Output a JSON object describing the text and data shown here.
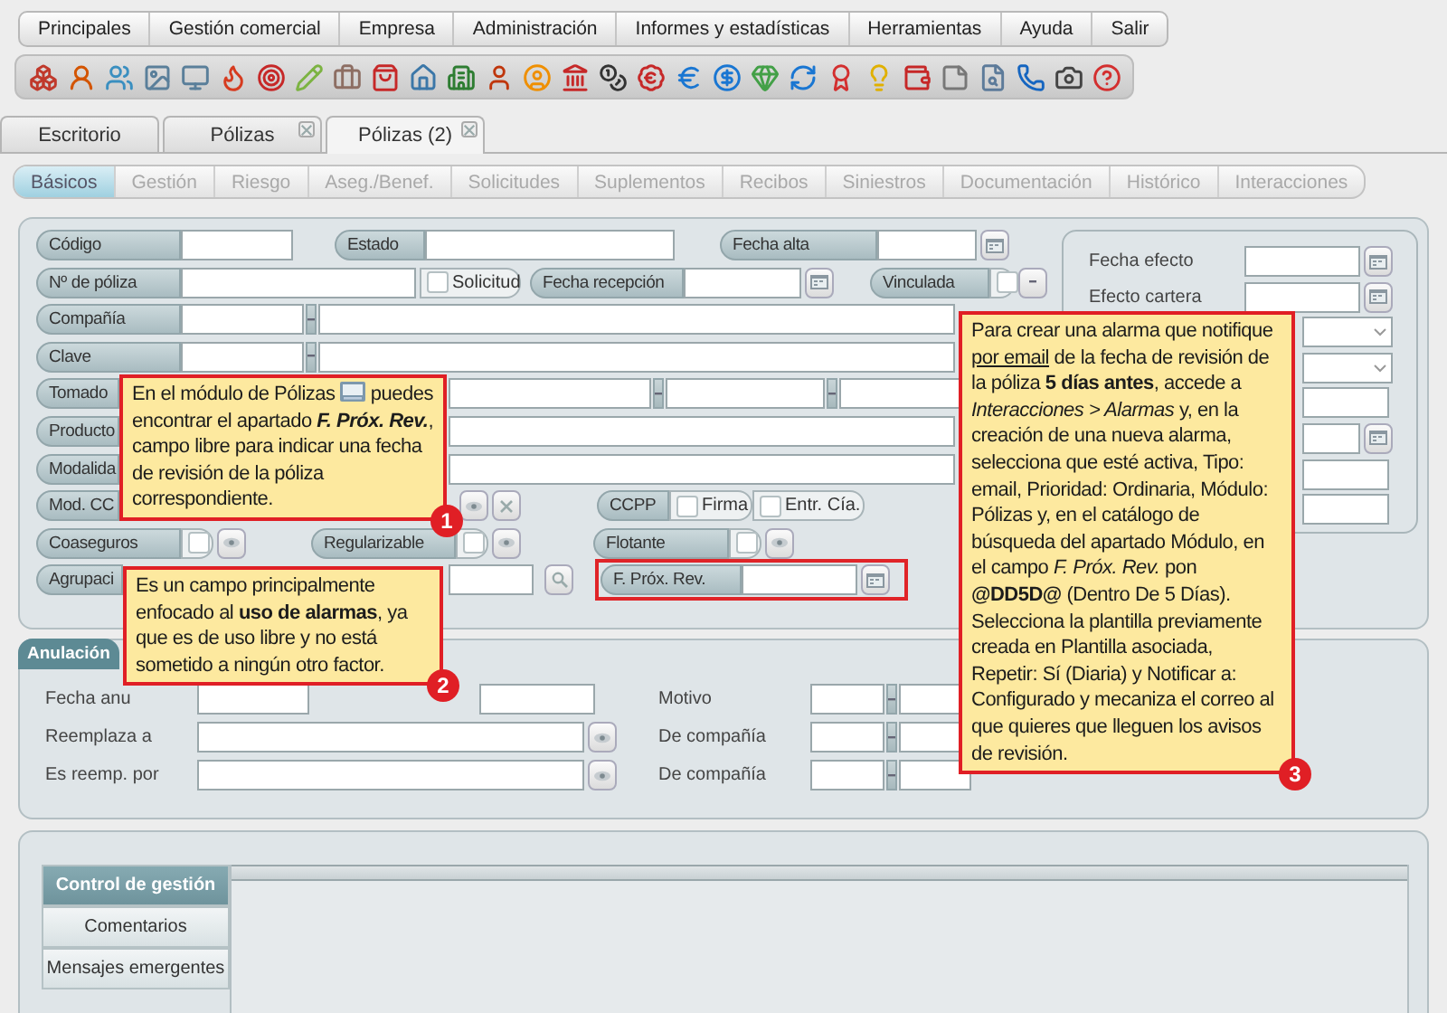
{
  "menu": [
    {
      "label": "Principales"
    },
    {
      "label": "Gestión comercial"
    },
    {
      "label": "Empresa"
    },
    {
      "label": "Administración"
    },
    {
      "label": "Informes y estadísticas"
    },
    {
      "label": "Herramientas"
    },
    {
      "label": "Ayuda"
    },
    {
      "label": "Salir"
    }
  ],
  "tabs": [
    {
      "label": "Escritorio",
      "selected": false,
      "closable": false
    },
    {
      "label": "Pólizas",
      "selected": false,
      "closable": true
    },
    {
      "label": "Pólizas (2)",
      "selected": true,
      "closable": true
    }
  ],
  "subtabs": [
    {
      "label": "Básicos",
      "selected": true,
      "disabled": false
    },
    {
      "label": "Gestión",
      "selected": false,
      "disabled": true
    },
    {
      "label": "Riesgo",
      "selected": false,
      "disabled": true
    },
    {
      "label": "Aseg./Benef.",
      "selected": false,
      "disabled": true
    },
    {
      "label": "Solicitudes",
      "selected": false,
      "disabled": true
    },
    {
      "label": "Suplementos",
      "selected": false,
      "disabled": true
    },
    {
      "label": "Recibos",
      "selected": false,
      "disabled": true
    },
    {
      "label": "Siniestros",
      "selected": false,
      "disabled": true
    },
    {
      "label": "Documentación",
      "selected": false,
      "disabled": true
    },
    {
      "label": "Histórico",
      "selected": false,
      "disabled": true
    },
    {
      "label": "Interacciones",
      "selected": false,
      "disabled": true
    }
  ],
  "policy_form": {
    "lines": [
      [
        {
          "kind": "label",
          "text": "Código"
        },
        {
          "kind": "input"
        },
        {
          "kind": "label",
          "text": "Estado"
        },
        {
          "kind": "input"
        },
        {
          "kind": "label",
          "text": "Fecha alta"
        },
        {
          "kind": "input"
        },
        {
          "kind": "calendar"
        }
      ],
      [
        {
          "kind": "label",
          "text": "Nº de póliza"
        },
        {
          "kind": "input"
        },
        {
          "kind": "checkbox",
          "text": "Solicitud",
          "checked": false
        },
        {
          "kind": "label",
          "text": "Fecha recepción"
        },
        {
          "kind": "input"
        },
        {
          "kind": "calendar"
        },
        {
          "kind": "label",
          "text": "Vinculada"
        },
        {
          "kind": "checkbox",
          "checked": false
        },
        {
          "kind": "spin"
        }
      ],
      [
        {
          "kind": "label",
          "text": "Compañía"
        },
        {
          "kind": "input"
        },
        {
          "kind": "sep"
        },
        {
          "kind": "input"
        }
      ],
      [
        {
          "kind": "label",
          "text": "Clave"
        },
        {
          "kind": "input"
        },
        {
          "kind": "sep"
        },
        {
          "kind": "input"
        }
      ],
      [
        {
          "kind": "label",
          "text": "Tomado"
        },
        {
          "kind": "input"
        },
        {
          "kind": "sep"
        },
        {
          "kind": "input"
        },
        {
          "kind": "sep"
        },
        {
          "kind": "input"
        }
      ],
      [
        {
          "kind": "label",
          "text": "Producto"
        },
        {
          "kind": "input"
        }
      ],
      [
        {
          "kind": "label",
          "text": "Modalida"
        },
        {
          "kind": "input"
        }
      ],
      [
        {
          "kind": "label",
          "text": "Mod. CC"
        },
        {
          "kind": "eye"
        },
        {
          "kind": "clear"
        },
        {
          "kind": "label",
          "text": "CCPP"
        },
        {
          "kind": "checkbox",
          "text": "Firma",
          "checked": false
        },
        {
          "kind": "checkbox",
          "text": "Entr. Cía.",
          "checked": false
        }
      ],
      [
        {
          "kind": "label",
          "text": "Coaseguros"
        },
        {
          "kind": "checkbox",
          "checked": false
        },
        {
          "kind": "eye"
        },
        {
          "kind": "label",
          "text": "Regularizable"
        },
        {
          "kind": "checkbox",
          "checked": false
        },
        {
          "kind": "eye"
        },
        {
          "kind": "label",
          "text": "Flotante"
        },
        {
          "kind": "checkbox",
          "checked": false
        },
        {
          "kind": "eye"
        }
      ],
      [
        {
          "kind": "label",
          "text": "Agrupaci"
        },
        {
          "kind": "input"
        },
        {
          "kind": "search"
        },
        {
          "kind": "label",
          "text": "F. Próx. Rev.",
          "highlighted": true
        },
        {
          "kind": "input",
          "highlighted": true
        },
        {
          "kind": "calendar",
          "highlighted": true
        }
      ]
    ]
  },
  "dates_panel": {
    "rows": [
      {
        "kind": "date",
        "label": "Fecha efecto"
      },
      {
        "kind": "date",
        "label": "Efecto cartera"
      },
      {
        "kind": "select"
      },
      {
        "kind": "select"
      },
      {
        "kind": "input"
      },
      {
        "kind": "date"
      },
      {
        "kind": "input"
      },
      {
        "kind": "input"
      }
    ]
  },
  "cancellation": {
    "title": "Anulación",
    "rows": [
      {
        "kind": "dates",
        "label": "Fecha anu",
        "right_label": "Motivo"
      },
      {
        "kind": "lookup",
        "label": "Reemplaza a",
        "right_label": "De compañía"
      },
      {
        "kind": "lookup",
        "label": "Es reemp. por",
        "right_label": "De compañía"
      }
    ]
  },
  "management": {
    "tabs": [
      {
        "label": "Control de gestión",
        "selected": true
      },
      {
        "label": "Comentarios",
        "selected": false
      },
      {
        "label": "Mensajes emergentes",
        "selected": false
      }
    ]
  },
  "callouts": [
    {
      "number": "1",
      "segments": [
        {
          "kind": "plain",
          "text": "En el módulo de Pólizas "
        },
        {
          "kind": "icon"
        },
        {
          "kind": "plain",
          "text": " puedes encontrar el apartado "
        },
        {
          "kind": "bolditalic",
          "text": "F. Próx. Rev."
        },
        {
          "kind": "plain",
          "text": ", campo libre para indicar una fecha de revisión de la póliza correspondiente."
        }
      ]
    },
    {
      "number": "2",
      "segments": [
        {
          "kind": "plain",
          "text": "Es un campo principalmente enfocado al "
        },
        {
          "kind": "bold",
          "text": "uso de alarmas"
        },
        {
          "kind": "plain",
          "text": ", ya que es de uso libre y no está sometido a ningún otro factor."
        }
      ]
    },
    {
      "number": "3",
      "segments": [
        {
          "kind": "plain",
          "text": "Para crear una alarma que notifique "
        },
        {
          "kind": "underline",
          "text": "por email"
        },
        {
          "kind": "plain",
          "text": " de la fecha de revisión de la póliza "
        },
        {
          "kind": "bold",
          "text": "5 días antes"
        },
        {
          "kind": "plain",
          "text": ", accede a "
        },
        {
          "kind": "italic",
          "text": "Interacciones > Alarmas"
        },
        {
          "kind": "plain",
          "text": " y, en la creación de una nueva alarma, selecciona que esté activa, Tipo: email, Prioridad: Ordinaria, Módulo: Pólizas y, en el catálogo de búsqueda del apartado Módulo, en el campo "
        },
        {
          "kind": "italic",
          "text": "F. Próx. Rev."
        },
        {
          "kind": "plain",
          "text": " pon "
        },
        {
          "kind": "bold",
          "text": "@DD5D@"
        },
        {
          "kind": "plain",
          "text": " (Dentro De 5 Días). Selecciona la plantilla previamente creada en Plantilla asociada, Repetir: Sí (Diaria) y Notificar a: Configurado y mecaniza el correo al que quieres que lleguen los avisos de revisión."
        }
      ]
    }
  ]
}
